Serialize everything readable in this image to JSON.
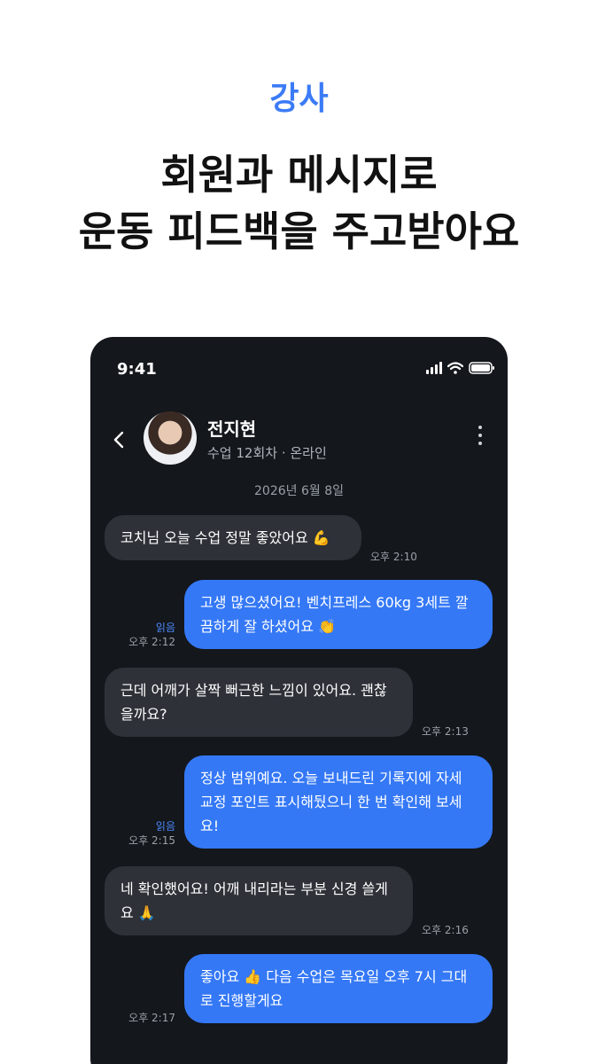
{
  "promo": {
    "tag": "강사",
    "headline_line1": "회원과 메시지로",
    "headline_line2": "운동 피드백을 주고받아요"
  },
  "status_bar": {
    "time": "9:41"
  },
  "chat_header": {
    "name": "전지현",
    "subtitle": "수업 12회차 · 온라인"
  },
  "date_divider": "2026년 6월 8일",
  "messages": [
    {
      "direction": "incoming",
      "text": "코치님 오늘 수업 정말 좋았어요 💪",
      "time": "오후 2:10"
    },
    {
      "direction": "outgoing",
      "text": "고생 많으셨어요! 벤치프레스 60kg 3세트 깔끔하게 잘 하셨어요 👏",
      "time": "오후 2:12",
      "read": "읽음"
    },
    {
      "direction": "incoming",
      "text": "근데 어깨가 살짝 뻐근한 느낌이 있어요. 괜찮을까요?",
      "time": "오후 2:13"
    },
    {
      "direction": "outgoing",
      "text": "정상 범위예요. 오늘 보내드린 기록지에 자세 교정 포인트 표시해뒀으니 한 번 확인해 보세요!",
      "time": "오후 2:15",
      "read": "읽음"
    },
    {
      "direction": "incoming",
      "text": "네 확인했어요! 어깨 내리라는 부분 신경 쓸게요 🙏",
      "time": "오후 2:16"
    },
    {
      "direction": "outgoing",
      "text": "좋아요 👍 다음 수업은 목요일 오후 7시 그대로 진행할게요",
      "time": "오후 2:17"
    }
  ],
  "colors": {
    "accent": "#3b7bf6",
    "phone_bg": "#14171c",
    "incoming_bubble": "#2e3138",
    "outgoing_bubble": "#3478f6"
  }
}
